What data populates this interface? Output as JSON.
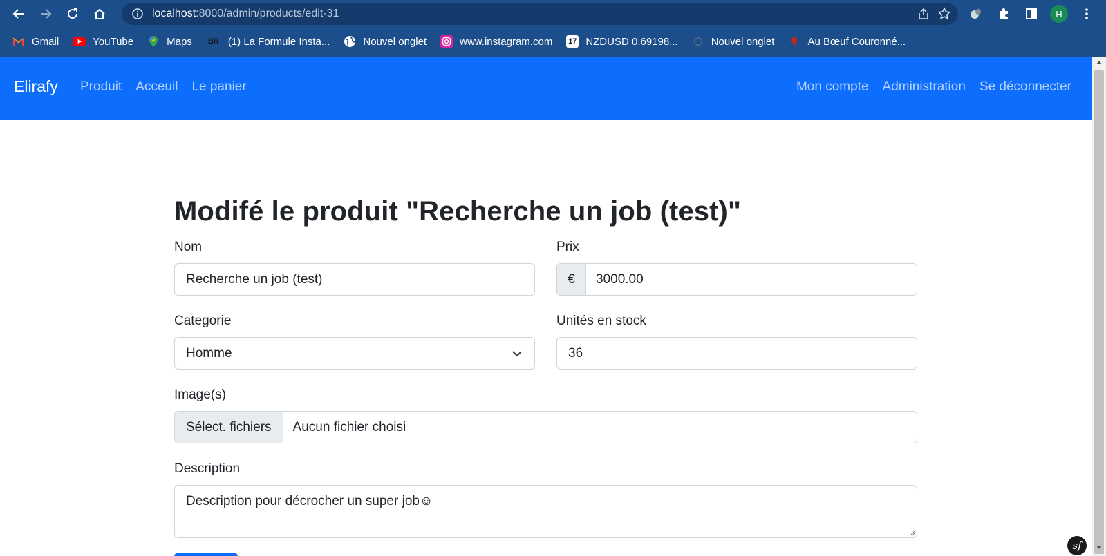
{
  "browser": {
    "url_host": "localhost",
    "url_path": ":8000/admin/products/edit-31",
    "profile_initial": "H",
    "bookmarks": [
      {
        "label": "Gmail",
        "icon": "gmail-icon"
      },
      {
        "label": "YouTube",
        "icon": "youtube-icon"
      },
      {
        "label": "Maps",
        "icon": "maps-icon"
      },
      {
        "label": "(1) La Formule Insta...",
        "icon": "br-icon",
        "icon_text": "BR"
      },
      {
        "label": "Nouvel onglet",
        "icon": "globe-icon"
      },
      {
        "label": "www.instagram.com",
        "icon": "instagram-icon"
      },
      {
        "label": "NZDUSD 0.69198...",
        "icon": "tradingview-icon",
        "icon_text": "17"
      },
      {
        "label": "Nouvel onglet",
        "icon": "tab-icon"
      },
      {
        "label": "Au Bœuf Couronné...",
        "icon": "restaurant-icon"
      }
    ]
  },
  "navbar": {
    "brand": "Elirafy",
    "left_links": [
      "Produit",
      "Acceuil",
      "Le panier"
    ],
    "right_links": [
      "Mon compte",
      "Administration",
      "Se déconnecter"
    ]
  },
  "form": {
    "title": "Modifé le produit \"Recherche un job (test)\"",
    "name_label": "Nom",
    "name_value": "Recherche un job (test)",
    "price_label": "Prix",
    "price_currency": "€",
    "price_value": "3000.00",
    "category_label": "Categorie",
    "category_value": "Homme",
    "stock_label": "Unités en stock",
    "stock_value": "36",
    "images_label": "Image(s)",
    "file_button": "Sélect. fichiers",
    "file_status": "Aucun fichier choisi",
    "description_label": "Description",
    "description_value": "Description pour décrocher un super job☺"
  },
  "colors": {
    "chrome": "#1c4e8b",
    "navbar": "#0d6efd",
    "nav_link": "#b6d2fe"
  }
}
